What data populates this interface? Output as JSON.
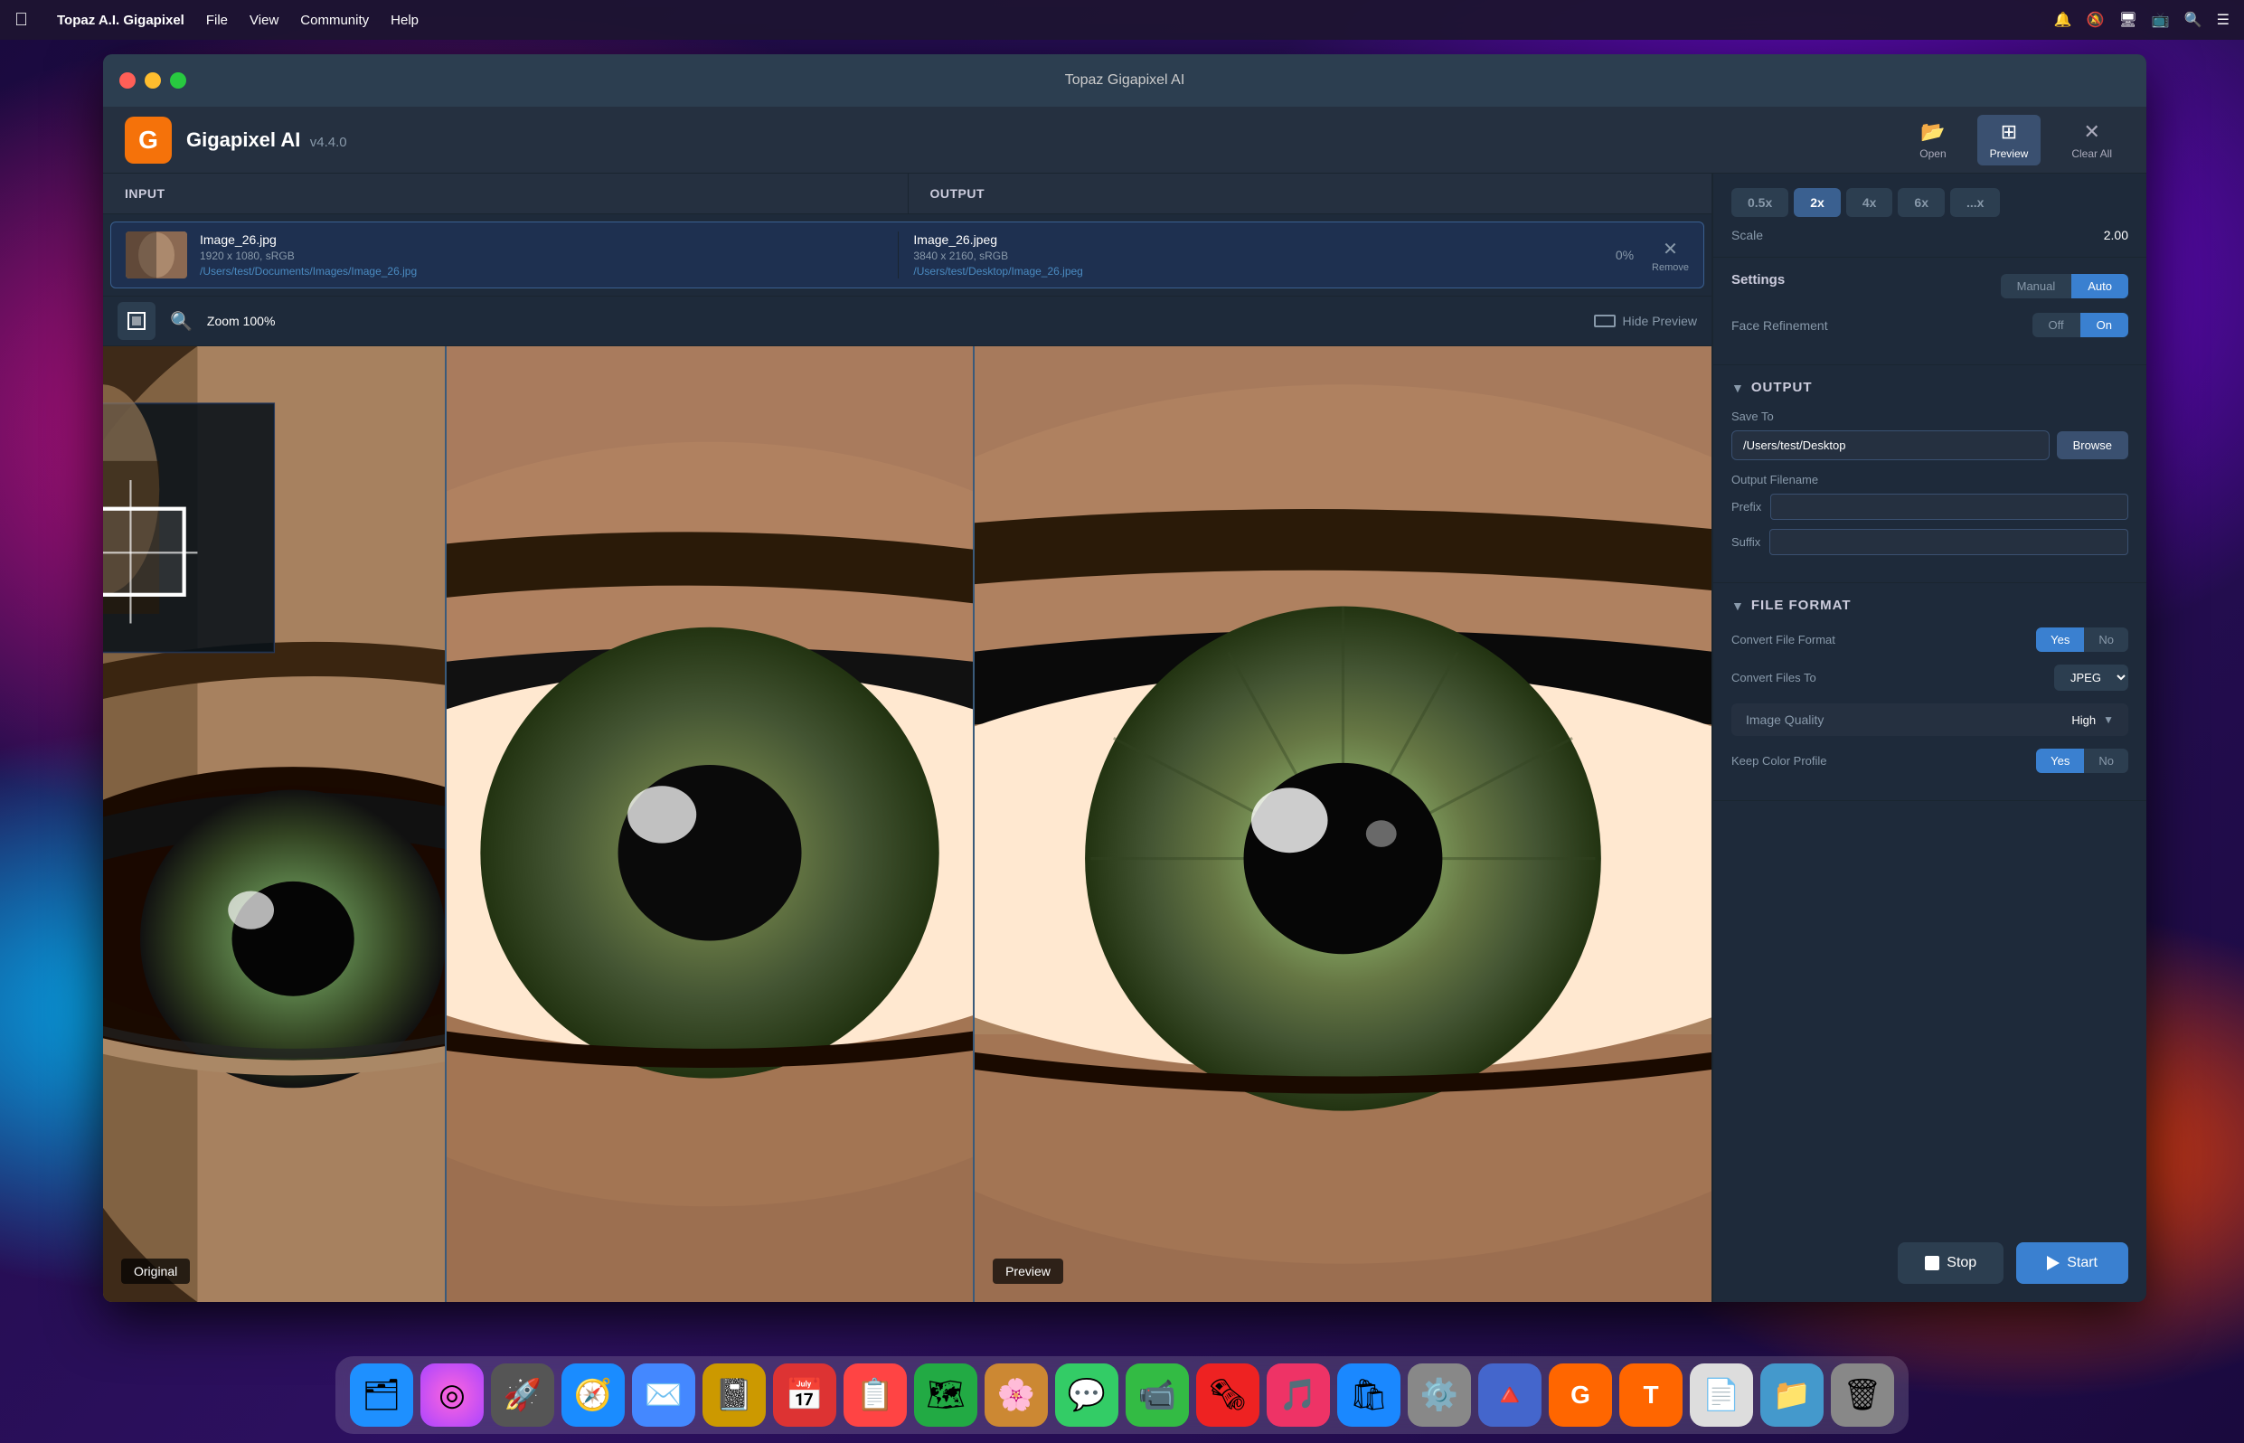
{
  "app": {
    "title": "Topaz Gigapixel AI",
    "version": "v4.4.0",
    "name": "Gigapixel AI"
  },
  "menubar": {
    "apple": "⌘",
    "app_name": "Topaz A.I. Gigapixel",
    "items": [
      "File",
      "View",
      "Community",
      "Help"
    ]
  },
  "window": {
    "title": "Topaz Gigapixel AI"
  },
  "toolbar": {
    "open_label": "Open",
    "preview_label": "Preview",
    "clear_all_label": "Clear All"
  },
  "file_list": {
    "input_header": "INPUT",
    "output_header": "OUTPUT",
    "files": [
      {
        "input_name": "Image_26.jpg",
        "input_meta": "1920 x 1080, sRGB",
        "input_path": "/Users/test/Documents/Images/Image_26.jpg",
        "output_name": "Image_26.jpeg",
        "output_meta": "3840 x 2160, sRGB",
        "output_path": "/Users/test/Desktop/Image_26.jpeg",
        "progress": "0%"
      }
    ]
  },
  "preview": {
    "zoom_label": "Zoom 100%",
    "hide_preview_label": "Hide Preview",
    "original_label": "Original",
    "preview_label": "Preview"
  },
  "right_panel": {
    "scale": {
      "label": "Scale",
      "value": "2.00",
      "buttons": [
        "0.5x",
        "2x",
        "4x",
        "6x",
        "...x"
      ],
      "active": "2x"
    },
    "settings": {
      "title": "Settings",
      "face_refinement": "Face Refinement",
      "manual_label": "Manual",
      "auto_label": "Auto",
      "off_label": "Off",
      "on_label": "On"
    },
    "output": {
      "section_title": "OUTPUT",
      "save_to_label": "Save To",
      "path": "/Users/test/Desktop",
      "browse_label": "Browse",
      "filename_label": "Output Filename",
      "prefix_label": "Prefix",
      "suffix_label": "Suffix"
    },
    "file_format": {
      "section_title": "FILE FORMAT",
      "convert_label": "Convert File Format",
      "convert_to_label": "Convert Files To",
      "format_value": "JPEG",
      "image_quality_label": "Image Quality",
      "quality_value": "High",
      "keep_color_label": "Keep Color Profile",
      "yes_label": "Yes",
      "no_label": "No"
    },
    "actions": {
      "stop_label": "Stop",
      "start_label": "Start"
    }
  },
  "dock": {
    "items": [
      {
        "name": "finder",
        "emoji": "🗂",
        "bg": "#1e90ff"
      },
      {
        "name": "siri",
        "emoji": "🔮",
        "bg": "#cc44cc"
      },
      {
        "name": "launchpad",
        "emoji": "🚀",
        "bg": "#333"
      },
      {
        "name": "safari",
        "emoji": "🧭",
        "bg": "#1a8cff"
      },
      {
        "name": "mail",
        "emoji": "✉️",
        "bg": "#4488ff"
      },
      {
        "name": "notes",
        "emoji": "📓",
        "bg": "#cc9900"
      },
      {
        "name": "calendar",
        "emoji": "📅",
        "bg": "#dd3333"
      },
      {
        "name": "reminders",
        "emoji": "📋",
        "bg": "#ff4444"
      },
      {
        "name": "maps",
        "emoji": "🗺",
        "bg": "#22aa44"
      },
      {
        "name": "photos",
        "emoji": "🌸",
        "bg": "#cc8833"
      },
      {
        "name": "messages",
        "emoji": "💬",
        "bg": "#33cc66"
      },
      {
        "name": "facetime",
        "emoji": "📹",
        "bg": "#33bb44"
      },
      {
        "name": "news",
        "emoji": "🗞",
        "bg": "#ee2222"
      },
      {
        "name": "music",
        "emoji": "🎵",
        "bg": "#ee3366"
      },
      {
        "name": "appstore",
        "emoji": "🛍",
        "bg": "#1a88ff"
      },
      {
        "name": "system-prefs",
        "emoji": "⚙️",
        "bg": "#888"
      },
      {
        "name": "altimeter",
        "emoji": "🔺",
        "bg": "#4466cc"
      },
      {
        "name": "topaz-g",
        "emoji": "G",
        "bg": "#ff6600"
      },
      {
        "name": "topaz-t",
        "emoji": "T",
        "bg": "#ff6600"
      },
      {
        "name": "docs",
        "emoji": "📄",
        "bg": "#cccccc"
      },
      {
        "name": "finder-2",
        "emoji": "📁",
        "bg": "#4499cc"
      },
      {
        "name": "trash",
        "emoji": "🗑",
        "bg": "#888"
      }
    ]
  }
}
